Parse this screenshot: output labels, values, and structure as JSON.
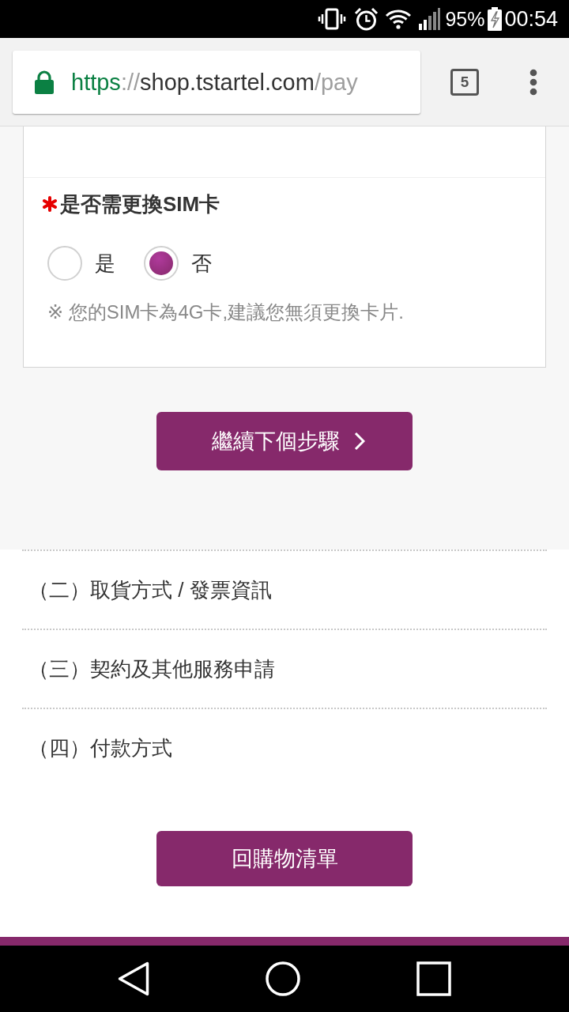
{
  "status_bar": {
    "battery": "95%",
    "time": "00:54"
  },
  "browser": {
    "url": {
      "scheme": "https",
      "separator": "://",
      "host": "shop.tstartel.com",
      "path": "/pay"
    },
    "tab_count": "5"
  },
  "sim_question": {
    "required": true,
    "label": "是否需更換SIM卡",
    "options": [
      {
        "label": "是",
        "selected": false
      },
      {
        "label": "否",
        "selected": true
      }
    ],
    "note": "※ 您的SIM卡為4G卡,建議您無須更換卡片."
  },
  "next_button": {
    "label": "繼續下個步驟"
  },
  "steps": [
    "（二）取貨方式 / 發票資訊",
    "（三）契約及其他服務申請",
    "（四）付款方式"
  ],
  "back_button": {
    "label": "回購物清單"
  }
}
